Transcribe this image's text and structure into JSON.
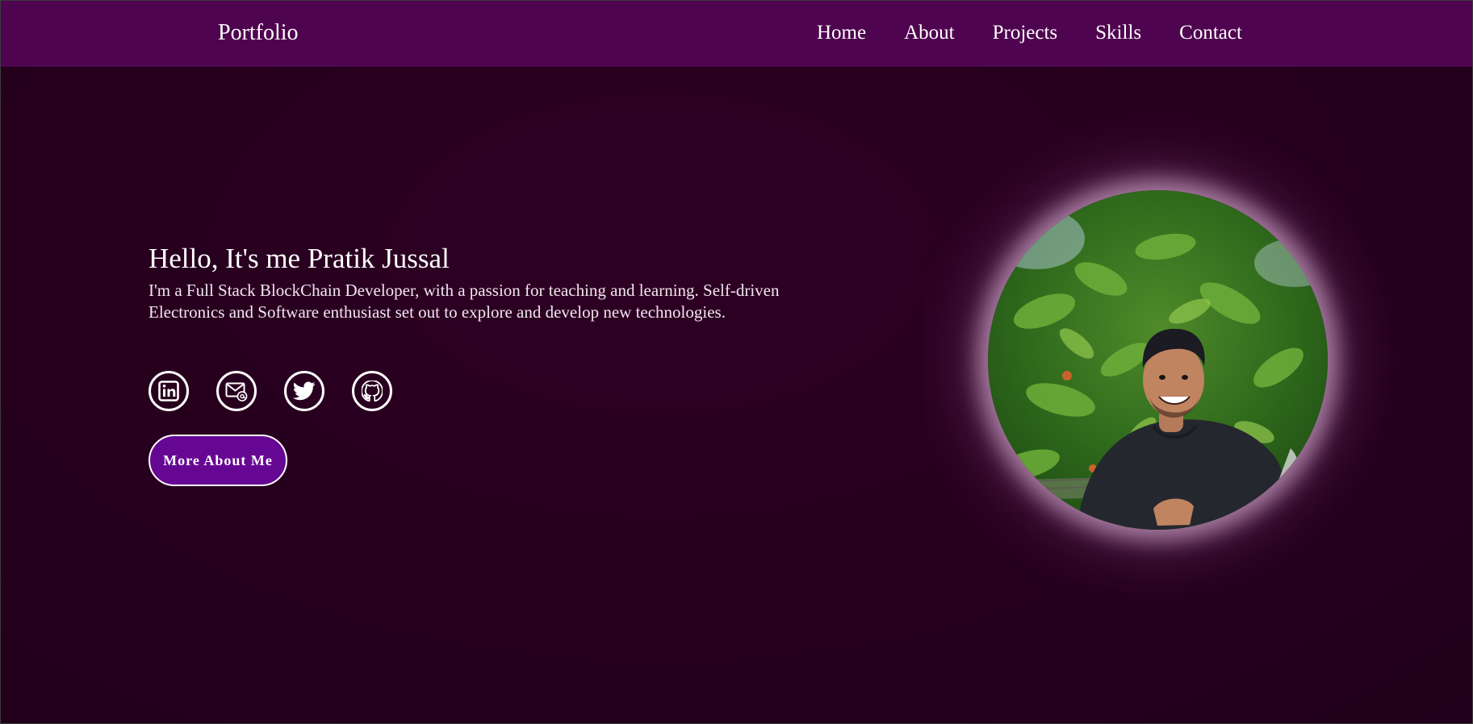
{
  "navbar": {
    "brand": "Portfolio",
    "links": [
      "Home",
      "About",
      "Projects",
      "Skills",
      "Contact"
    ]
  },
  "hero": {
    "title": "Hello, It's me Pratik Jussal",
    "description": "I'm a Full Stack BlockChain Developer, with a passion for teaching and learning. Self-driven Electronics and Software enthusiast set out to explore and develop new technologies.",
    "button_label": "More About Me"
  },
  "socials": [
    {
      "icon": "linkedin-icon"
    },
    {
      "icon": "email-icon"
    },
    {
      "icon": "twitter-icon"
    },
    {
      "icon": "github-icon"
    }
  ],
  "colors": {
    "navbar": "#4f0450",
    "background": "#27001e",
    "button": "#660794",
    "text": "#ffffff"
  }
}
